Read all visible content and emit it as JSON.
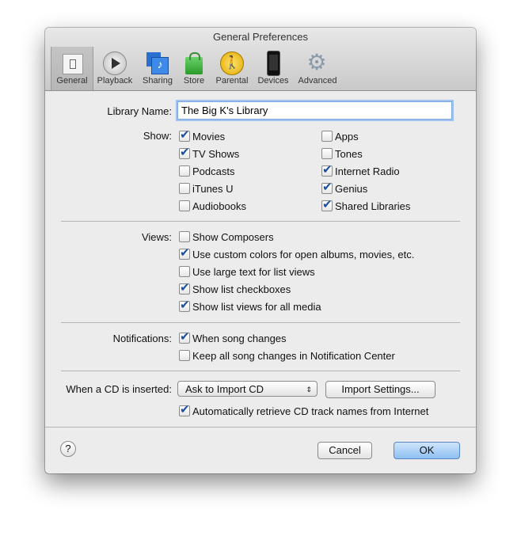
{
  "window": {
    "title": "General Preferences"
  },
  "toolbar": [
    {
      "label": "General",
      "icon": "switch-icon",
      "selected": true
    },
    {
      "label": "Playback",
      "icon": "play-icon"
    },
    {
      "label": "Sharing",
      "icon": "sharing-icon"
    },
    {
      "label": "Store",
      "icon": "shopping-bag-icon"
    },
    {
      "label": "Parental",
      "icon": "parental-icon"
    },
    {
      "label": "Devices",
      "icon": "iphone-icon"
    },
    {
      "label": "Advanced",
      "icon": "gear-icon"
    }
  ],
  "library": {
    "label": "Library Name:",
    "value": "The Big K's Library"
  },
  "show": {
    "label": "Show:",
    "left": [
      {
        "label": "Movies",
        "checked": true
      },
      {
        "label": "TV Shows",
        "checked": true
      },
      {
        "label": "Podcasts",
        "checked": false
      },
      {
        "label": "iTunes U",
        "checked": false
      },
      {
        "label": "Audiobooks",
        "checked": false
      }
    ],
    "right": [
      {
        "label": "Apps",
        "checked": false
      },
      {
        "label": "Tones",
        "checked": false
      },
      {
        "label": "Internet Radio",
        "checked": true
      },
      {
        "label": "Genius",
        "checked": true
      },
      {
        "label": "Shared Libraries",
        "checked": true
      }
    ]
  },
  "views": {
    "label": "Views:",
    "items": [
      {
        "label": "Show Composers",
        "checked": false
      },
      {
        "label": "Use custom colors for open albums, movies, etc.",
        "checked": true
      },
      {
        "label": "Use large text for list views",
        "checked": false
      },
      {
        "label": "Show list checkboxes",
        "checked": true
      },
      {
        "label": "Show list views for all media",
        "checked": true
      }
    ]
  },
  "notifications": {
    "label": "Notifications:",
    "items": [
      {
        "label": "When song changes",
        "checked": true
      },
      {
        "label": "Keep all song changes in Notification Center",
        "checked": false
      }
    ]
  },
  "cd": {
    "label": "When a CD is inserted:",
    "selected": "Ask to Import CD",
    "import_settings": "Import Settings...",
    "auto": {
      "label": "Automatically retrieve CD track names from Internet",
      "checked": true
    }
  },
  "footer": {
    "help": "?",
    "cancel": "Cancel",
    "ok": "OK"
  },
  "colors": {
    "accent": "#1c4ea0",
    "ok_button": "#8ec0f2"
  }
}
